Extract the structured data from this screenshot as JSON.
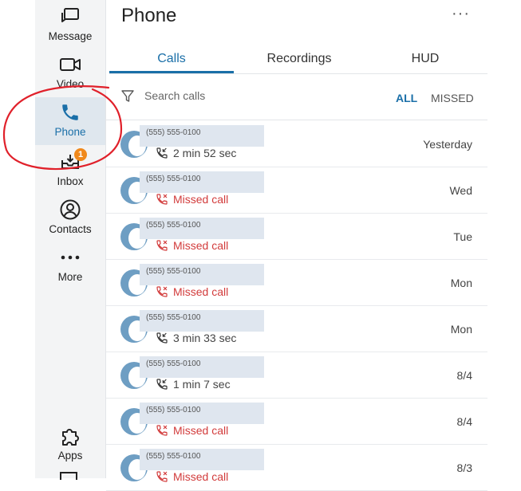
{
  "nav": {
    "items": [
      {
        "key": "message",
        "label": "Message",
        "icon": "message-icon"
      },
      {
        "key": "video",
        "label": "Video",
        "icon": "video-icon"
      },
      {
        "key": "phone",
        "label": "Phone",
        "icon": "phone-icon",
        "active": true
      },
      {
        "key": "inbox",
        "label": "Inbox",
        "icon": "inbox-icon",
        "badge": "1"
      },
      {
        "key": "contacts",
        "label": "Contacts",
        "icon": "contacts-icon"
      },
      {
        "key": "more",
        "label": "More",
        "icon": "more-icon"
      },
      {
        "key": "apps",
        "label": "Apps",
        "icon": "apps-icon"
      }
    ]
  },
  "header": {
    "title": "Phone",
    "more_glyph": "···"
  },
  "tabs": [
    {
      "label": "Calls",
      "active": true
    },
    {
      "label": "Recordings",
      "active": false
    },
    {
      "label": "HUD",
      "active": false
    }
  ],
  "search": {
    "placeholder": "Search calls"
  },
  "filters": {
    "all": "ALL",
    "missed": "MISSED"
  },
  "calls": [
    {
      "number": "(555) 555-0100",
      "detail": "2 min 52 sec",
      "missed": false,
      "when": "Yesterday"
    },
    {
      "number": "(555) 555-0100",
      "detail": "Missed call",
      "missed": true,
      "when": "Wed"
    },
    {
      "number": "(555) 555-0100",
      "detail": "Missed call",
      "missed": true,
      "when": "Tue"
    },
    {
      "number": "(555) 555-0100",
      "detail": "Missed call",
      "missed": true,
      "when": "Mon"
    },
    {
      "number": "(555) 555-0100",
      "detail": "3 min 33 sec",
      "missed": false,
      "when": "Mon"
    },
    {
      "number": "(555) 555-0100",
      "detail": "1 min 7 sec",
      "missed": false,
      "when": "8/4"
    },
    {
      "number": "(555) 555-0100",
      "detail": "Missed call",
      "missed": true,
      "when": "8/4"
    },
    {
      "number": "(555) 555-0100",
      "detail": "Missed call",
      "missed": true,
      "when": "8/3"
    }
  ],
  "colors": {
    "accent": "#1a6fa8",
    "missed": "#d23b3b",
    "badge": "#f0891c",
    "annotation": "#e0202a"
  }
}
